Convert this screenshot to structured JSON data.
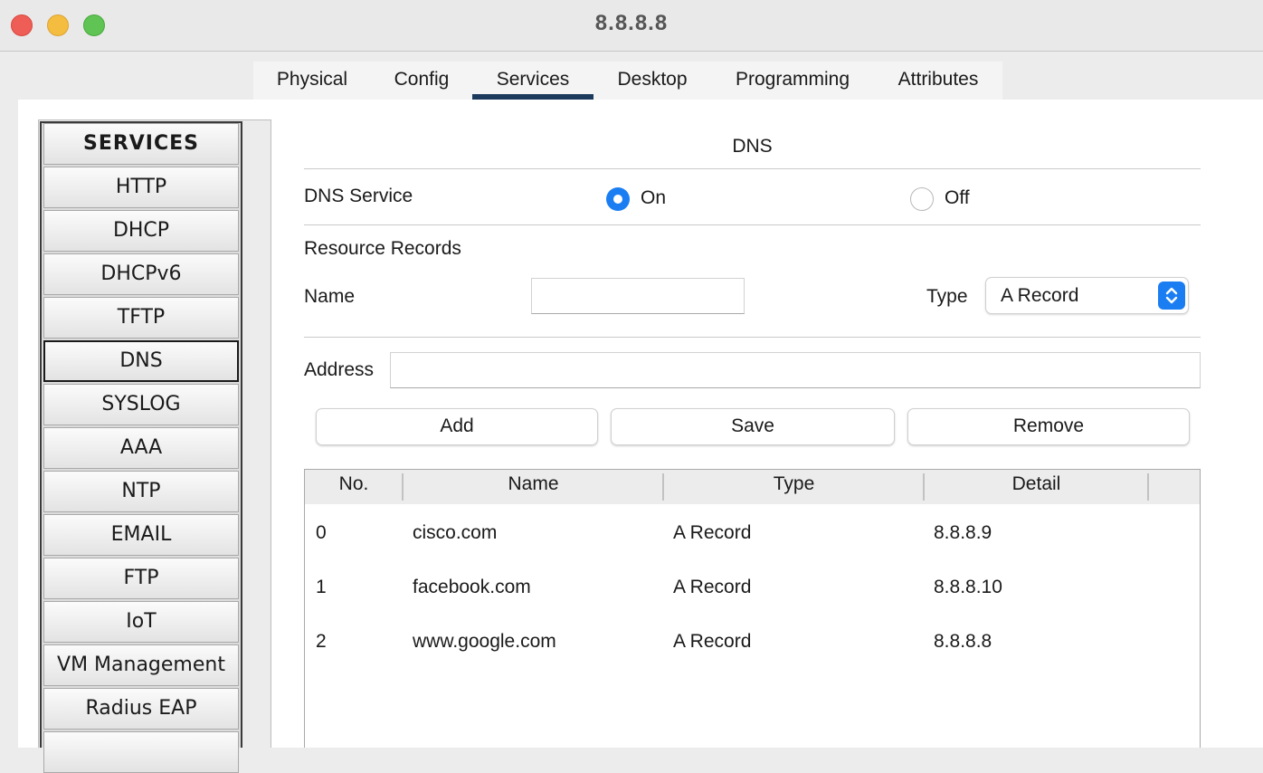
{
  "window": {
    "title": "8.8.8.8"
  },
  "tabs": [
    {
      "label": "Physical"
    },
    {
      "label": "Config"
    },
    {
      "label": "Services",
      "active": true
    },
    {
      "label": "Desktop"
    },
    {
      "label": "Programming"
    },
    {
      "label": "Attributes"
    }
  ],
  "sidebar": {
    "header": "SERVICES",
    "items": [
      "HTTP",
      "DHCP",
      "DHCPv6",
      "TFTP",
      "DNS",
      "SYSLOG",
      "AAA",
      "NTP",
      "EMAIL",
      "FTP",
      "IoT",
      "VM Management",
      "Radius EAP"
    ],
    "selected": "DNS"
  },
  "dns": {
    "title": "DNS",
    "service_label": "DNS Service",
    "on_label": "On",
    "off_label": "Off",
    "service_state": "On",
    "resource_records_label": "Resource Records",
    "name_label": "Name",
    "name_value": "",
    "type_label": "Type",
    "type_value": "A Record",
    "address_label": "Address",
    "address_value": "",
    "buttons": {
      "add": "Add",
      "save": "Save",
      "remove": "Remove"
    }
  },
  "table": {
    "headers": [
      "No.",
      "Name",
      "Type",
      "Detail"
    ],
    "rows": [
      [
        "0",
        "cisco.com",
        "A Record",
        "8.8.8.9"
      ],
      [
        "1",
        "facebook.com",
        "A Record",
        "8.8.8.10"
      ],
      [
        "2",
        "www.google.com",
        "A Record",
        "8.8.8.8"
      ]
    ]
  },
  "colors": {
    "accent": "#1a7ef2",
    "tab_indicator": "#1c3a5e",
    "close": "#ee5e56",
    "minimize": "#f5bd3f",
    "maximize": "#5fc453"
  }
}
